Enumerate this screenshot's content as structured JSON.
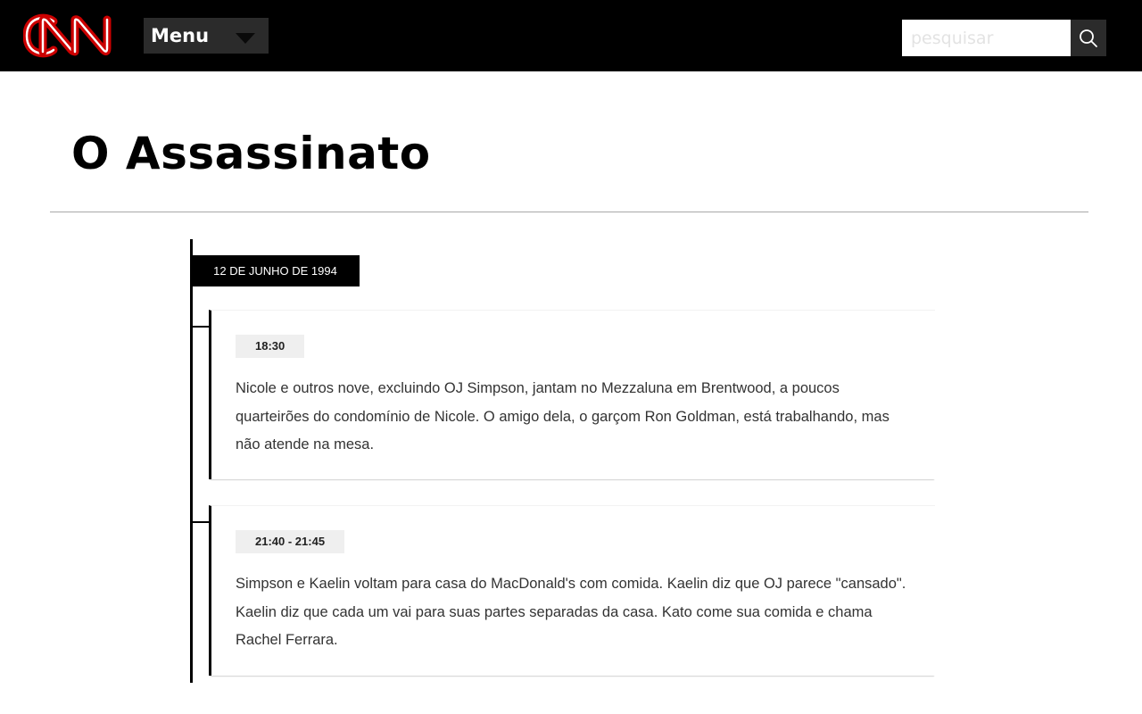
{
  "header": {
    "logo_text": "CNN",
    "menu_label": "Menu",
    "search_placeholder": "pesquisar",
    "search_value": ""
  },
  "page": {
    "title": "O Assassinato"
  },
  "timeline": {
    "date_label": "12 DE JUNHO DE 1994",
    "events": [
      {
        "time": "18:30",
        "text": "Nicole e outros nove, excluindo OJ Simpson, jantam no Mezzaluna em Brentwood, a poucos quarteirões do condomínio de Nicole. O amigo dela, o garçom Ron Goldman, está trabalhando, mas não atende na mesa."
      },
      {
        "time": "21:40 - 21:45",
        "text": "Simpson e Kaelin voltam para casa do MacDonald's com comida. Kaelin diz que OJ parece \"cansado\". Kaelin diz que cada um vai para suas partes separadas da casa. Kato come sua comida e chama Rachel Ferrara."
      }
    ]
  },
  "colors": {
    "header_bg": "#000000",
    "logo_red": "#cc0000",
    "menu_bg": "#2b2b2b",
    "badge_bg": "#efefef"
  }
}
